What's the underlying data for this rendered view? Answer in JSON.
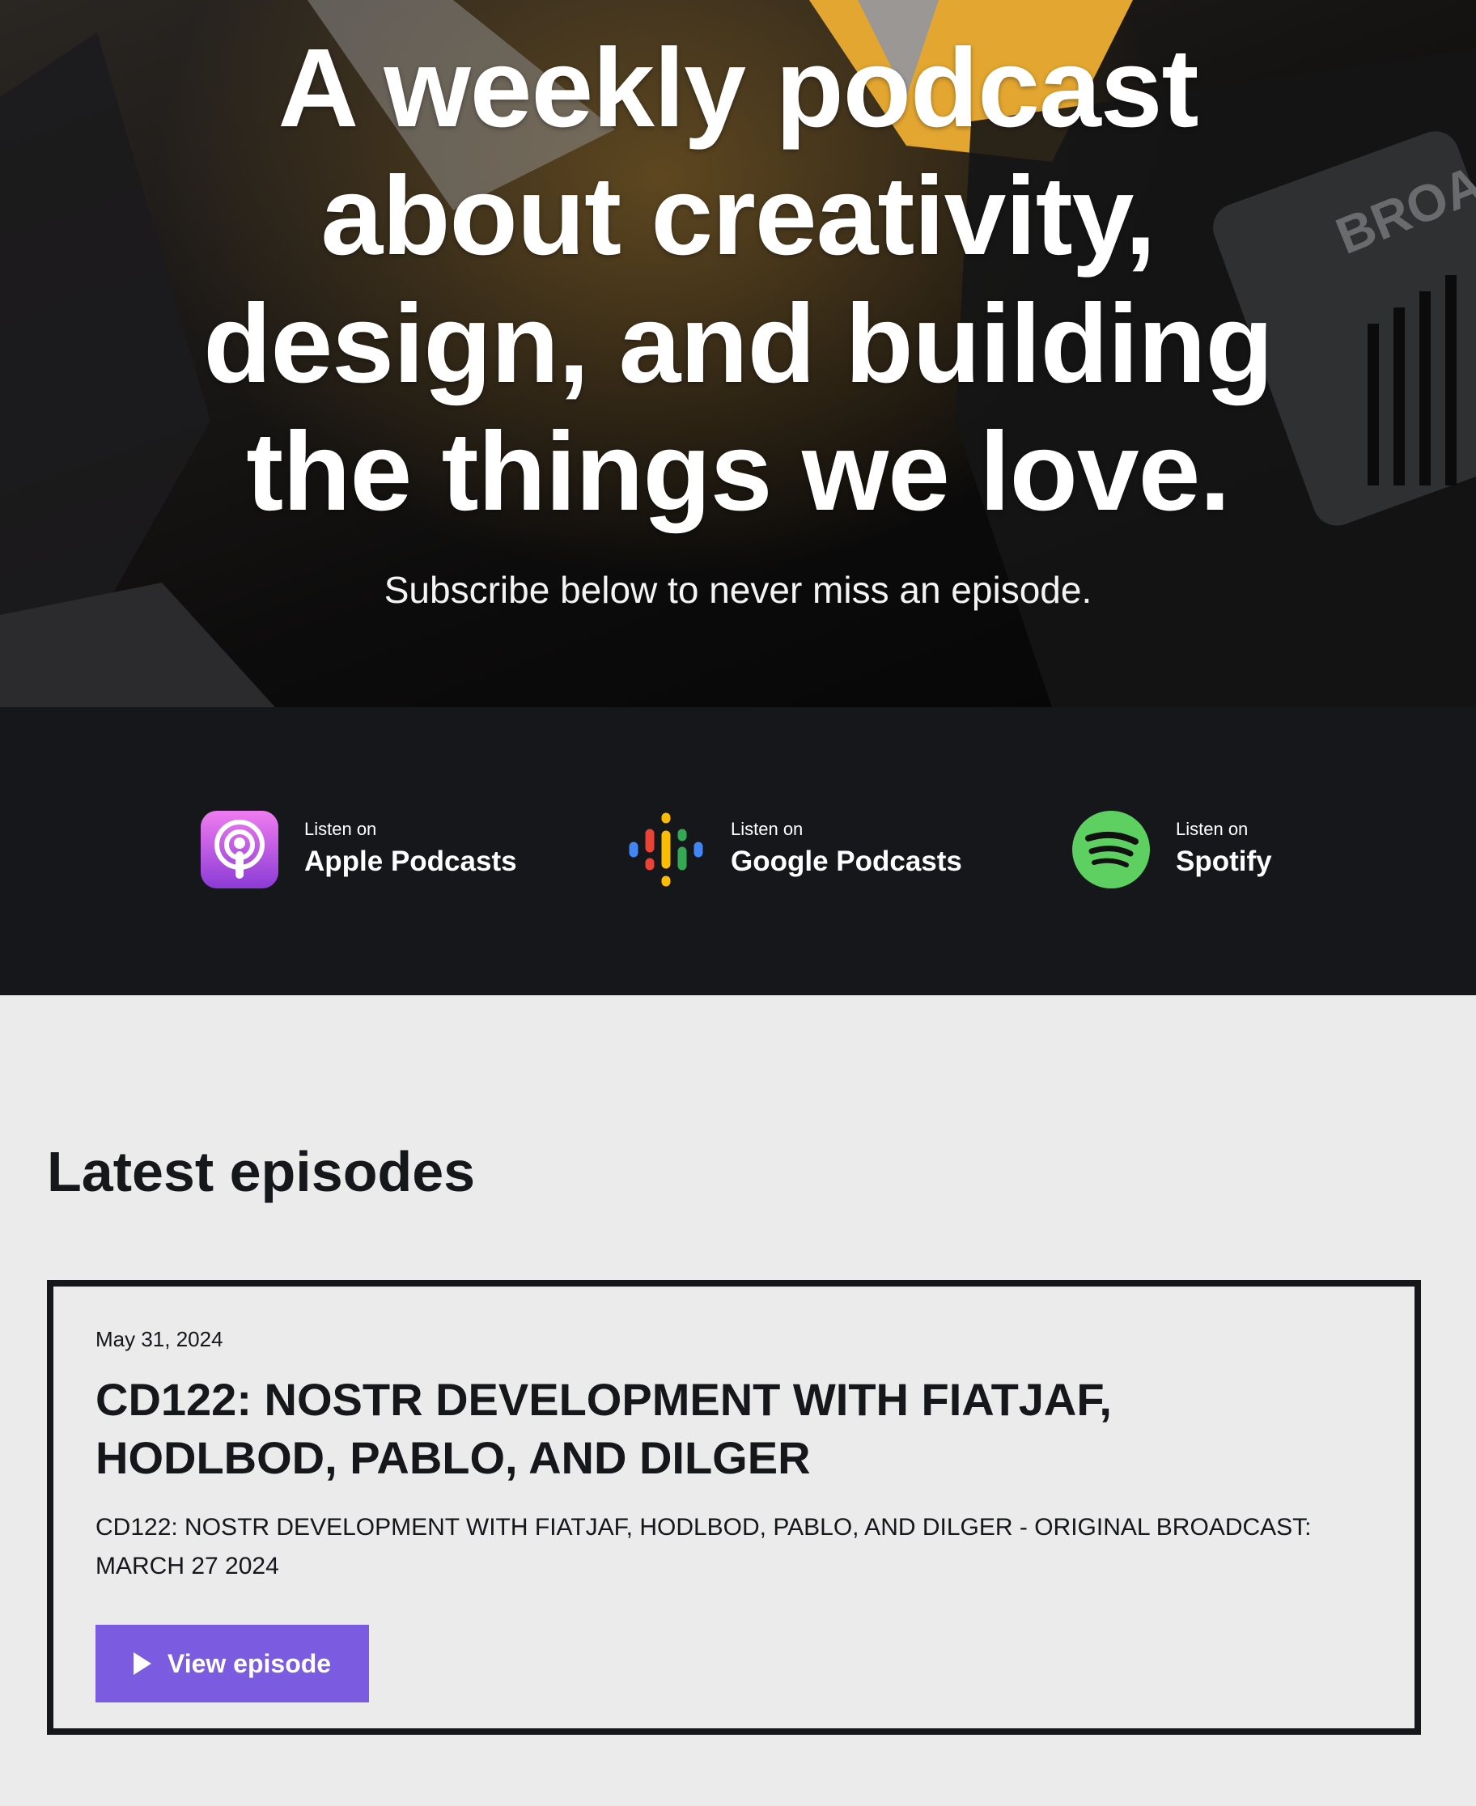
{
  "hero": {
    "title": "A weekly podcast about creativity, design, and building the things we love.",
    "subtitle": "Subscribe below to never miss an episode.",
    "bg_text": "BROA"
  },
  "platforms": [
    {
      "small": "Listen on",
      "name": "Apple Podcasts",
      "icon": "apple-podcasts-icon"
    },
    {
      "small": "Listen on",
      "name": "Google Podcasts",
      "icon": "google-podcasts-icon"
    },
    {
      "small": "Listen on",
      "name": "Spotify",
      "icon": "spotify-icon"
    }
  ],
  "latest": {
    "heading": "Latest episodes",
    "episode": {
      "date": "May 31, 2024",
      "title": "CD122: NOSTR DEVELOPMENT WITH FIATJAF, HODLBOD, PABLO, AND DILGER",
      "description": "CD122: NOSTR DEVELOPMENT WITH FIATJAF, HODLBOD, PABLO, AND DILGER - ORIGINAL BROADCAST: MARCH 27 2024",
      "button_label": "View episode"
    }
  },
  "colors": {
    "dark": "#16171b",
    "accent": "#7b5ce0",
    "page_bg": "#ebebeb",
    "spotify": "#5ed062",
    "apple": "#b150e2"
  }
}
